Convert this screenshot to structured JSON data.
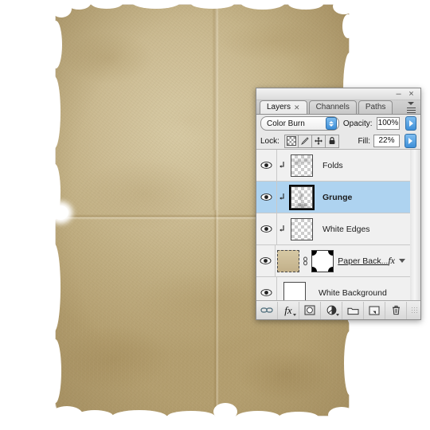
{
  "document": {
    "canvas_description": "aged folded paper texture",
    "paper_color": "#cdbd95",
    "paper_edge_color": "#8a6f3e",
    "background_color": "#ffffff"
  },
  "panel": {
    "title": "Layers",
    "window_buttons": {
      "minimize": "–",
      "close": "×"
    },
    "menu_icon": "panel-menu-icon",
    "tabs": [
      {
        "label": "Layers",
        "active": true,
        "closable": true,
        "close_glyph": "✕"
      },
      {
        "label": "Channels",
        "active": false,
        "closable": false
      },
      {
        "label": "Paths",
        "active": false,
        "closable": false
      }
    ],
    "blend": {
      "mode": "Color Burn",
      "opacity_label": "Opacity:",
      "opacity_value": "100%",
      "fill_label": "Fill:",
      "fill_value": "22%"
    },
    "lock": {
      "label": "Lock:",
      "buttons": [
        {
          "name": "lock-transparency",
          "icon": "checkerboard-icon"
        },
        {
          "name": "lock-image-pixels",
          "icon": "brush-icon"
        },
        {
          "name": "lock-position",
          "icon": "move-icon"
        },
        {
          "name": "lock-all",
          "icon": "lock-icon"
        }
      ]
    },
    "layers": [
      {
        "name": "Folds",
        "visible": true,
        "selected": false,
        "clipped": true,
        "thumb": "transparent-grunge",
        "has_mask": false,
        "has_fx": false,
        "linked": false
      },
      {
        "name": "Grunge",
        "visible": true,
        "selected": true,
        "clipped": true,
        "thumb": "transparent-grunge",
        "has_mask": false,
        "has_fx": false,
        "linked": false
      },
      {
        "name": "White Edges",
        "visible": true,
        "selected": false,
        "clipped": true,
        "thumb": "transparent-empty",
        "has_mask": false,
        "has_fx": false,
        "linked": false
      },
      {
        "name": "Paper Back...",
        "visible": true,
        "selected": false,
        "clipped": false,
        "thumb": "paper-texture",
        "has_mask": true,
        "has_fx": true,
        "fx_label": "fx",
        "linked": true
      },
      {
        "name": "White Background",
        "visible": true,
        "selected": false,
        "clipped": false,
        "thumb": "solid-white",
        "has_mask": false,
        "has_fx": false,
        "linked": false
      }
    ],
    "bottom_tools": [
      {
        "name": "link-layers-button",
        "icon": "chain-link-icon"
      },
      {
        "name": "layer-style-button",
        "icon": "fx-icon",
        "label": "fx"
      },
      {
        "name": "add-layer-mask-button",
        "icon": "mask-icon"
      },
      {
        "name": "adjustment-layer-button",
        "icon": "half-circle-icon"
      },
      {
        "name": "new-group-button",
        "icon": "folder-icon"
      },
      {
        "name": "new-layer-button",
        "icon": "new-layer-icon"
      },
      {
        "name": "delete-layer-button",
        "icon": "trash-icon"
      }
    ],
    "selection_color": "#aed3f0"
  }
}
